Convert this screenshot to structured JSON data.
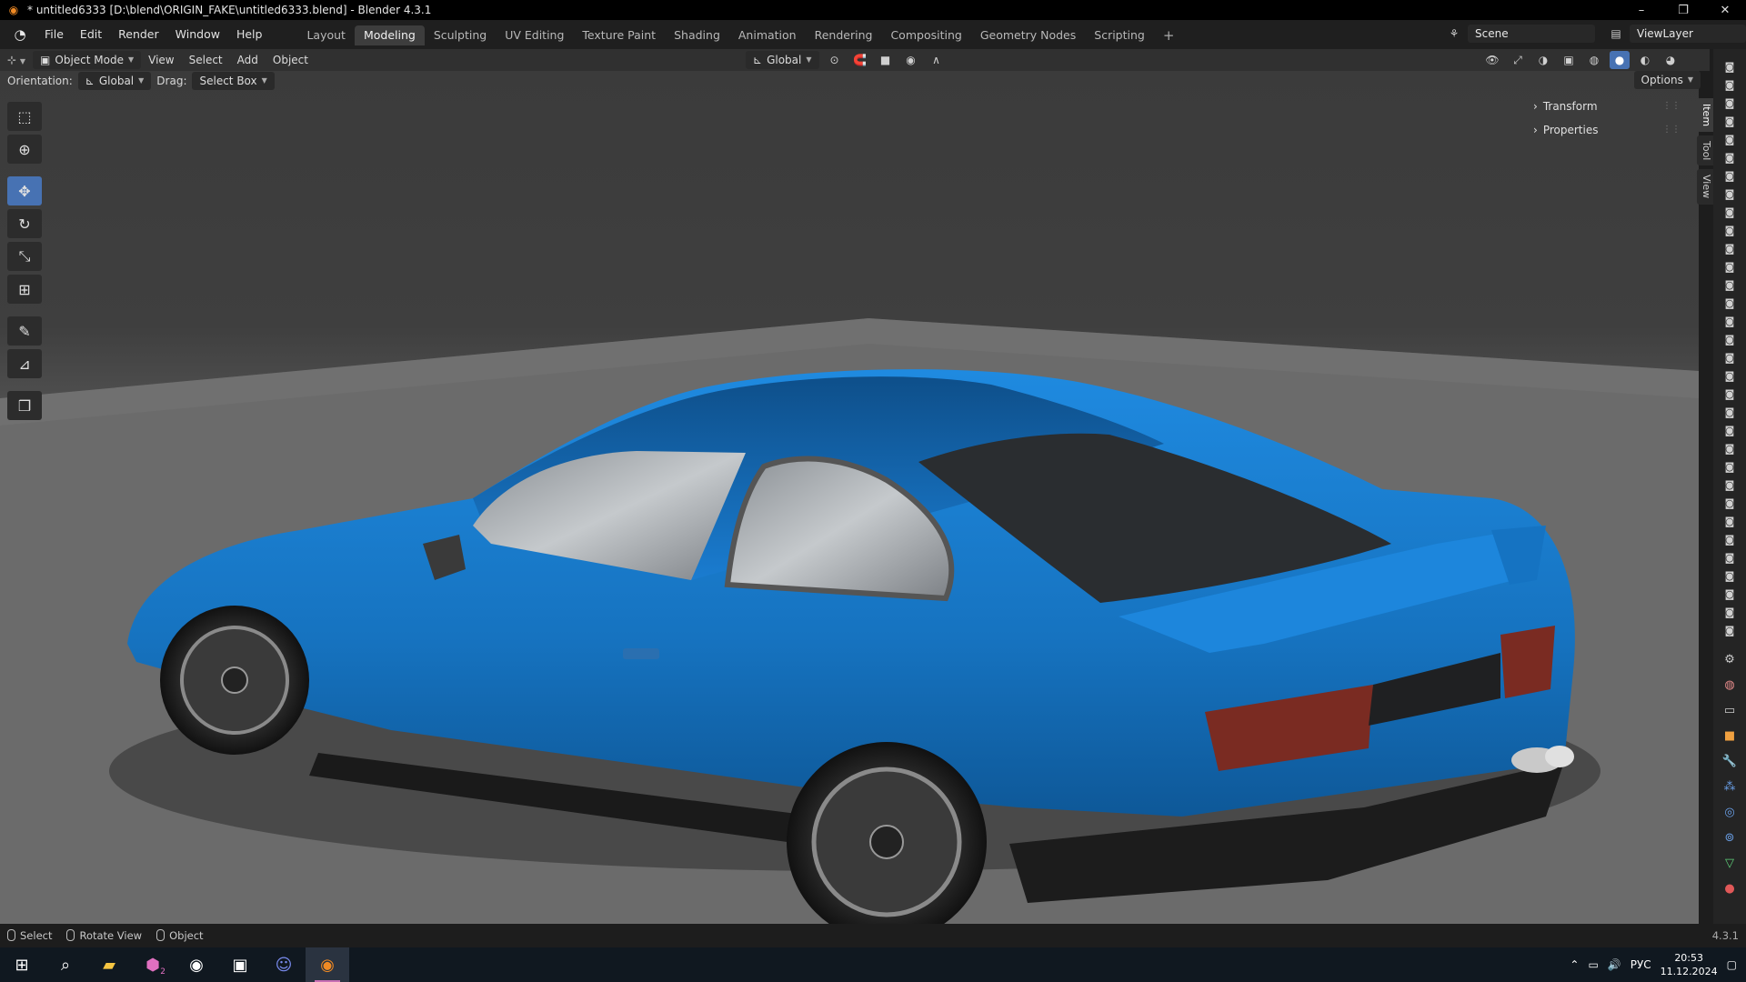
{
  "window": {
    "title": "* untitled6333 [D:\\blend\\ORIGIN_FAKE\\untitled6333.blend] - Blender 4.3.1",
    "controls": [
      "–",
      "❐",
      "✕"
    ]
  },
  "menu": [
    "File",
    "Edit",
    "Render",
    "Window",
    "Help"
  ],
  "workspace_tabs": [
    {
      "label": "Layout",
      "active": false
    },
    {
      "label": "Modeling",
      "active": true
    },
    {
      "label": "Sculpting",
      "active": false
    },
    {
      "label": "UV Editing",
      "active": false
    },
    {
      "label": "Texture Paint",
      "active": false
    },
    {
      "label": "Shading",
      "active": false
    },
    {
      "label": "Animation",
      "active": false
    },
    {
      "label": "Rendering",
      "active": false
    },
    {
      "label": "Compositing",
      "active": false
    },
    {
      "label": "Geometry Nodes",
      "active": false
    },
    {
      "label": "Scripting",
      "active": false
    }
  ],
  "add_tab": "+",
  "scene": "Scene",
  "view_layer": "ViewLayer",
  "viewport_header": {
    "mode": "Object Mode",
    "menus": [
      "View",
      "Select",
      "Add",
      "Object"
    ],
    "transform_orientation": "Global"
  },
  "tool_settings": {
    "orientation_label": "Orientation:",
    "orientation_value": "Global",
    "drag_label": "Drag:",
    "drag_value": "Select Box",
    "options": "Options"
  },
  "toolbar": [
    {
      "name": "select-box-tool",
      "icon": "⬚",
      "active": false
    },
    {
      "name": "cursor-tool",
      "icon": "⊕",
      "active": false
    },
    {
      "name": "move-tool",
      "icon": "✥",
      "active": true
    },
    {
      "name": "rotate-tool",
      "icon": "↻",
      "active": false
    },
    {
      "name": "scale-tool",
      "icon": "⤡",
      "active": false
    },
    {
      "name": "transform-tool",
      "icon": "⊞",
      "active": false
    },
    {
      "name": "annotate-tool",
      "icon": "✎",
      "active": false
    },
    {
      "name": "measure-tool",
      "icon": "📐",
      "active": false
    },
    {
      "name": "add-cube-tool",
      "icon": "❒",
      "active": false
    }
  ],
  "npanel": {
    "sections": [
      "Transform",
      "Properties"
    ],
    "tabs": [
      "Item",
      "Tool",
      "View"
    ]
  },
  "status_bar": {
    "items": [
      "Select",
      "Rotate View",
      "Object"
    ],
    "version": "4.3.1"
  },
  "taskbar": {
    "badge": "2",
    "time": "20:53",
    "date": "11.12.2024",
    "lang": "РУС"
  },
  "colors": {
    "accent": "#4772b3",
    "car_body": "#1b7fd0",
    "blender_orange": "#f08a24"
  }
}
